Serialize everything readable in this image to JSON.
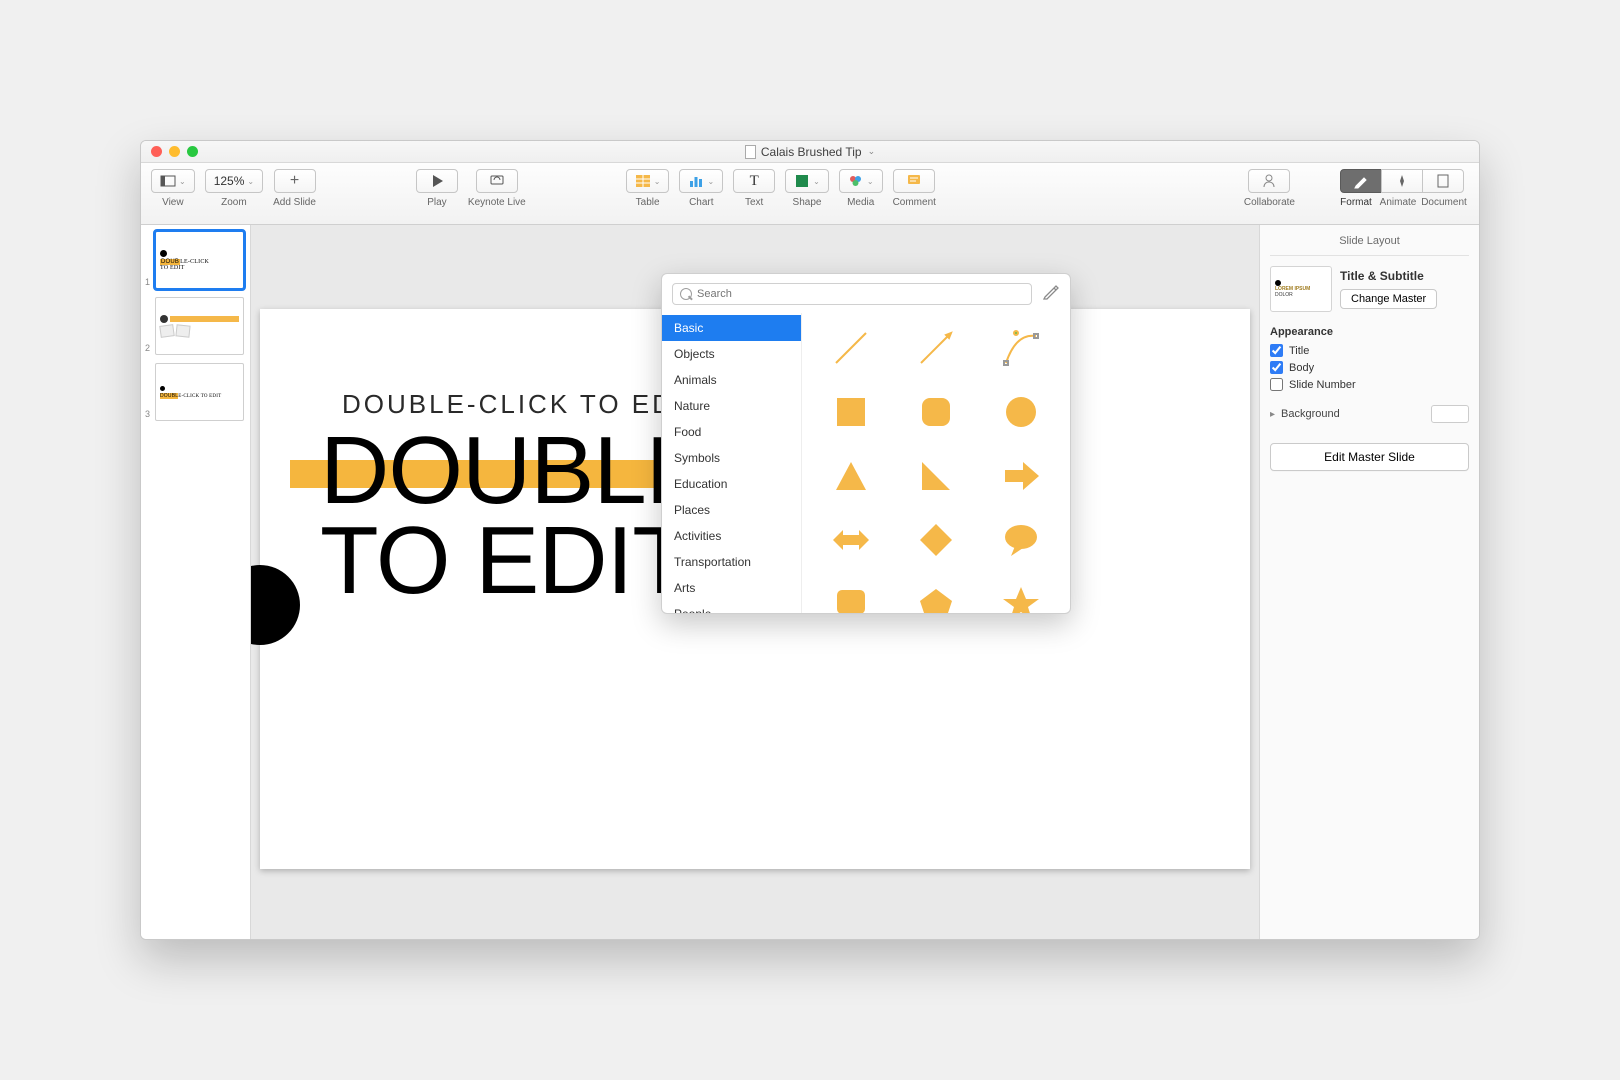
{
  "window": {
    "title": "Calais Brushed Tip"
  },
  "toolbar": {
    "view": "View",
    "zoom_value": "125%",
    "zoom": "Zoom",
    "add_slide": "Add Slide",
    "play": "Play",
    "keynote_live": "Keynote Live",
    "table": "Table",
    "chart": "Chart",
    "text": "Text",
    "shape": "Shape",
    "media": "Media",
    "comment": "Comment",
    "collaborate": "Collaborate",
    "format": "Format",
    "animate": "Animate",
    "document": "Document"
  },
  "thumbs": {
    "t1": "DOUBLE-CLICK TO EDIT",
    "t3": "DOUBLE-CLICK TO EDIT"
  },
  "canvas": {
    "subtitle": "DOUBLE-CLICK TO EDIT",
    "title_l1": "DOUBLE-CLICK",
    "title_l2": "TO EDIT"
  },
  "popover": {
    "search_placeholder": "Search",
    "categories": {
      "basic": "Basic",
      "objects": "Objects",
      "animals": "Animals",
      "nature": "Nature",
      "food": "Food",
      "symbols": "Symbols",
      "education": "Education",
      "places": "Places",
      "activities": "Activities",
      "transportation": "Transportation",
      "arts": "Arts",
      "people": "People"
    }
  },
  "inspector": {
    "header": "Slide Layout",
    "layout_name": "Title & Subtitle",
    "change_master": "Change Master",
    "appearance": "Appearance",
    "cb_title": "Title",
    "cb_body": "Body",
    "cb_slidenum": "Slide Number",
    "background": "Background",
    "edit_master": "Edit Master Slide"
  }
}
